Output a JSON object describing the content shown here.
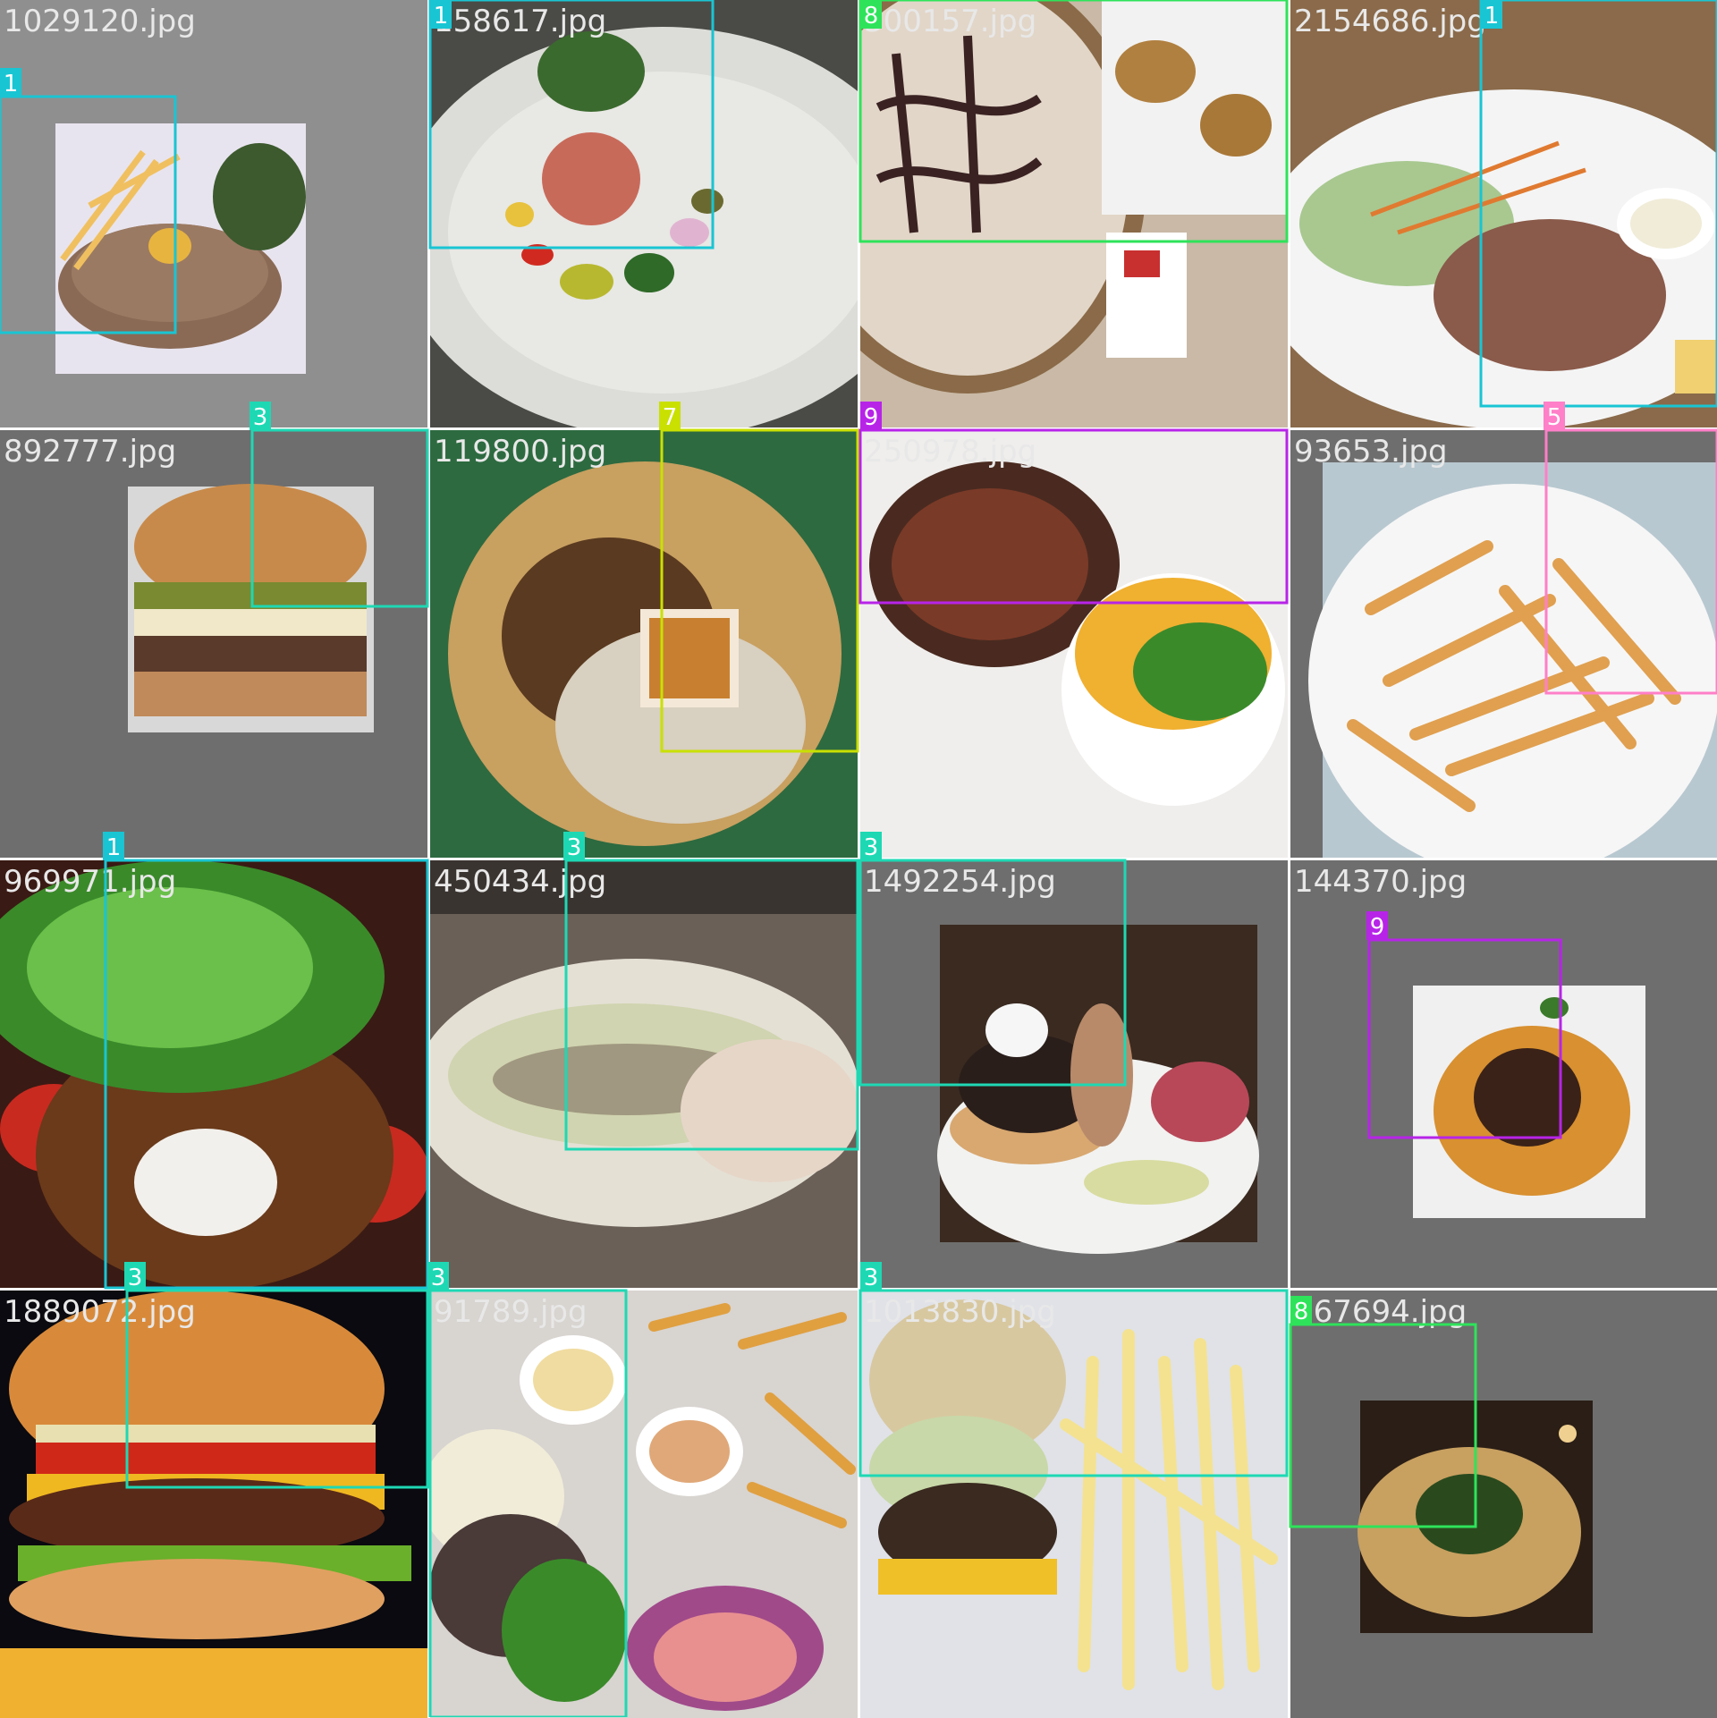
{
  "grid": {
    "columns": 4,
    "rows": 4
  },
  "class_colors": {
    "1": "#19c5d3",
    "3": "#1ed8b4",
    "5": "#ff7fc8",
    "7": "#c9e000",
    "8": "#2ee35a",
    "9": "#b724e8"
  },
  "tiles": [
    {
      "filename": "1029120.jpg",
      "labels": [
        "1"
      ]
    },
    {
      "filename": "158617.jpg",
      "labels": [
        "1"
      ]
    },
    {
      "filename": "300157.jpg",
      "labels": [
        "8"
      ]
    },
    {
      "filename": "2154686.jpg",
      "labels": [
        "1"
      ]
    },
    {
      "filename": "892777.jpg",
      "labels": [
        "3"
      ]
    },
    {
      "filename": "119800.jpg",
      "labels": [
        "7"
      ]
    },
    {
      "filename": "250978.jpg",
      "labels": [
        "9"
      ]
    },
    {
      "filename": "93653.jpg",
      "labels": [
        "5"
      ]
    },
    {
      "filename": "969971.jpg",
      "labels": [
        "1"
      ]
    },
    {
      "filename": "450434.jpg",
      "labels": [
        "3"
      ]
    },
    {
      "filename": "1492254.jpg",
      "labels": [
        "3"
      ]
    },
    {
      "filename": "144370.jpg",
      "labels": [
        "9"
      ]
    },
    {
      "filename": "1889072.jpg",
      "labels": [
        "3"
      ]
    },
    {
      "filename": "91789.jpg",
      "labels": [
        "3"
      ]
    },
    {
      "filename": "1013830.jpg",
      "labels": [
        "3"
      ]
    },
    {
      "filename": "867694.jpg",
      "labels": [
        "8"
      ]
    }
  ]
}
